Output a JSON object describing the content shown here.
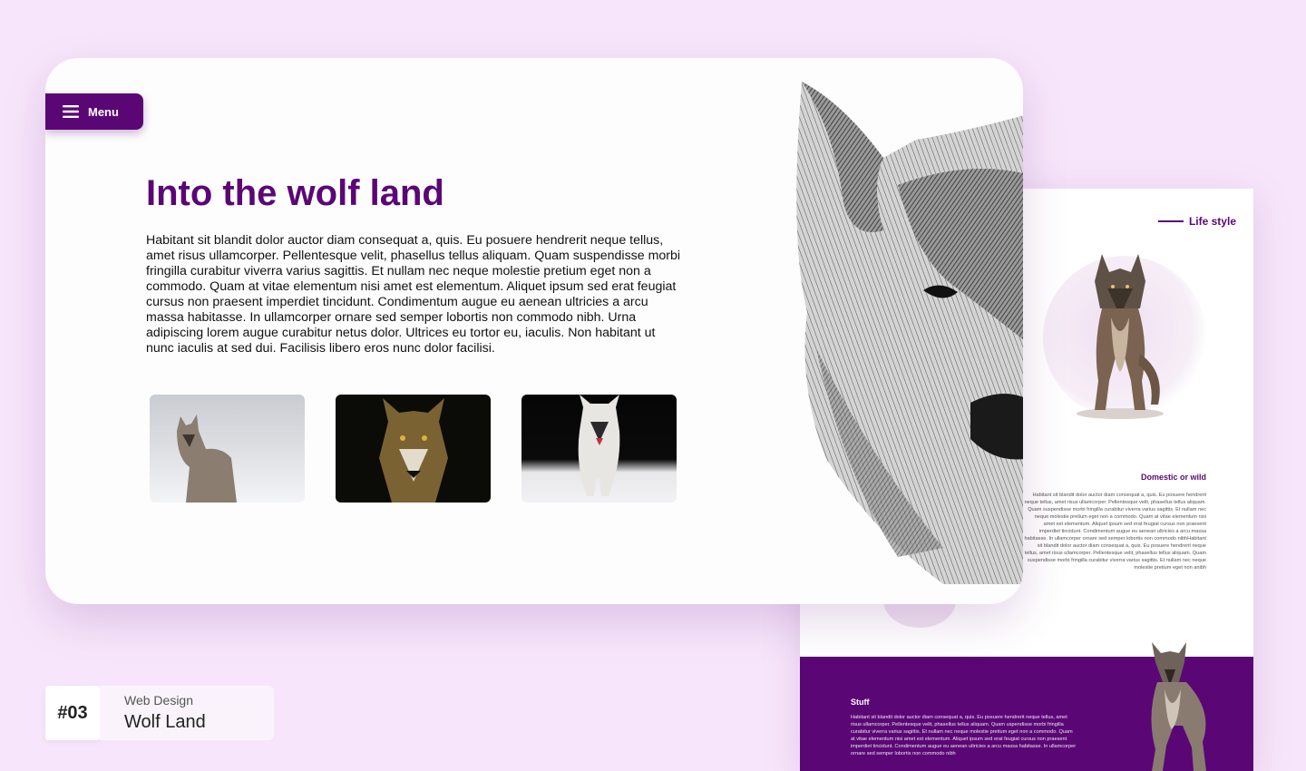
{
  "colors": {
    "brand": "#5a0775",
    "background": "#f7e6fb"
  },
  "hero": {
    "menu_label": "Menu",
    "title": "Into the wolf land",
    "body": "Habitant sit blandit dolor auctor diam consequat a, quis. Eu posuere hendrerit neque tellus, amet risus ullamcorper. Pellentesque velit, phasellus tellus aliquam. Quam suspendisse morbi fringilla curabitur viverra varius sagittis. Et nullam nec neque molestie pretium eget non a commodo. Quam at vitae elementum nisi amet est elementum. Aliquet ipsum sed erat feugiat cursus non praesent imperdiet tincidunt. Condimentum augue eu aenean ultricies a arcu massa habitasse. In ullamcorper ornare sed semper lobortis non commodo nibh. Urna adipiscing lorem augue curabitur netus dolor. Ultrices eu tortor eu, iaculis. Non habitant ut nunc iaculis at sed dui. Facilisis libero eros nunc dolor facilisi."
  },
  "back_page": {
    "life_style_label": "Life style",
    "domestic_title": "Domestic or wild",
    "domestic_body": "Habitant sit blandit dolor auctor diam consequat a, quis. Eu posuere hendrerit neque tellus, amet risus ullamcorper. Pellentesque velit, phasellus tellus aliquam. Quam suspendisse morbi fringilla curabitur viverra varius sagittis. Et nullam nec neque molestie pretium eget non a commodo. Quam at vitae elementum nisi amet est elementum. Aliquet ipsum sed erat feugiat cursus non praesent imperdiet tincidunt. Condimentum augue eu aenean ultricies a arcu massa habitasse. In ullamcorper ornare sed semper lobortis non commodo nibhHabitant sit blandit dolor auctor diam consequat a, quis. Eu posuere hendrerit neque tellus, amet risus ullamcorper. Pellentesque velit, phasellus tellus aliquam. Quam suspendisse morbi fringilla curabitur viverra varius sagittis. Et nullam nec neque molestie pretium eget non anibh",
    "stuff_title": "Stuff",
    "stuff_body": "Habitant sit blandit dolor auctor diam consequat a, quis. Eu posuere hendrerit neque tellus, amet risus ullamcorper. Pellentesque velit, phasellus tellus aliquam. Quam uspendisse morbi fringilla curabitur viverra varius sagittis. Et nullam nec neque molestie pretium eget non a commodo. Quam at vitae elementum nisi amet est elementum. Aliquet ipsum sed erat feugiat cursus non praesent imperdiet tincidunt. Condimentum augue eu aenean ultricies a arcu massa habitasse. In ullamcorper ornare sed semper lobortis non commodo nibh"
  },
  "project": {
    "number": "#03",
    "category": "Web Design",
    "name": "Wolf Land"
  }
}
